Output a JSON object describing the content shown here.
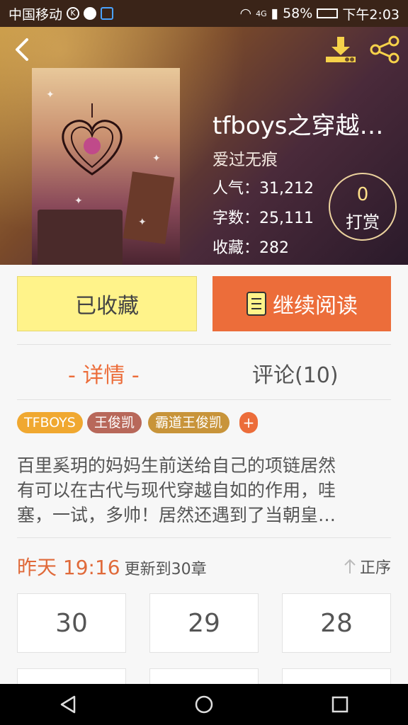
{
  "status_bar": {
    "carrier": "中国移动",
    "network": "4G",
    "battery": "58%",
    "time": "下午2:03"
  },
  "book": {
    "title": "tfboys之穿越…",
    "author": "爱过无痕",
    "stats": [
      {
        "label": "人气：",
        "value": "31,212"
      },
      {
        "label": "字数：",
        "value": "25,111"
      },
      {
        "label": "收藏：",
        "value": "282"
      }
    ],
    "tip": {
      "count": "0",
      "label": "打赏"
    }
  },
  "actions": {
    "favorite_label": "已收藏",
    "read_label": "继续阅读"
  },
  "tabs": [
    {
      "label": "- 详情 -",
      "active": true
    },
    {
      "label": "评论(10)",
      "active": false
    }
  ],
  "tags": [
    {
      "label": "TFBOYS",
      "color": "#f0a830"
    },
    {
      "label": "王俊凯",
      "color": "#b8685a"
    },
    {
      "label": "霸道王俊凯",
      "color": "#c8943a"
    },
    {
      "label": "+",
      "color": "#ec6d3a"
    }
  ],
  "description": [
    "百里奚玥的妈妈生前送给自己的项链居然",
    "有可以在古代与现代穿越自如的作用，哇",
    "塞，一试，多帅！居然还遇到了当朝皇…"
  ],
  "update": {
    "time": "昨天 19:16",
    "text": "更新到30章",
    "order_label": "正序"
  },
  "chapters": [
    "30",
    "29",
    "28"
  ],
  "colors": {
    "accent": "#ec6d3a",
    "favorite_bg": "#fff38a"
  }
}
